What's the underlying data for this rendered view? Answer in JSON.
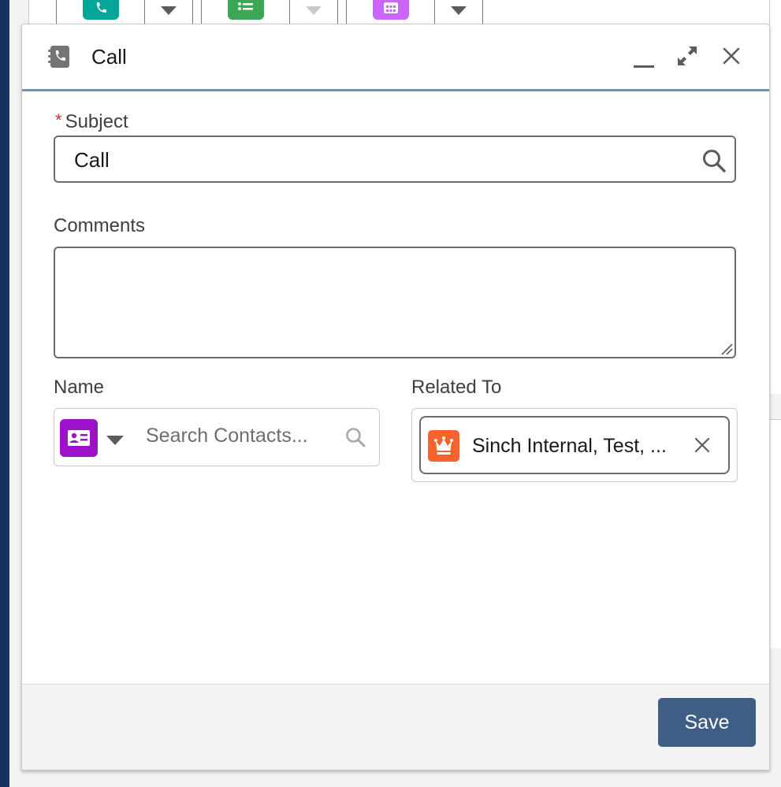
{
  "modal": {
    "title": "Call",
    "header_icon": "call-log-icon",
    "controls": [
      "minimize-icon",
      "expand-icon",
      "close-icon"
    ]
  },
  "form": {
    "subject": {
      "label": "Subject",
      "required_marker": "*",
      "value": "Call"
    },
    "comments": {
      "label": "Comments",
      "value": ""
    },
    "name": {
      "label": "Name",
      "placeholder": "Search Contacts...",
      "object_icon": "contact-card-icon"
    },
    "related_to": {
      "label": "Related To",
      "value": "Sinch Internal, Test, ...",
      "object_icon": "crown-icon"
    }
  },
  "footer": {
    "save_label": "Save"
  },
  "colors": {
    "primary_button": "#3e5e85",
    "header_accent": "#6b93c4",
    "contact_icon_bg": "#9b12c8",
    "related_icon_bg": "#f7622d",
    "required": "#c23934"
  }
}
